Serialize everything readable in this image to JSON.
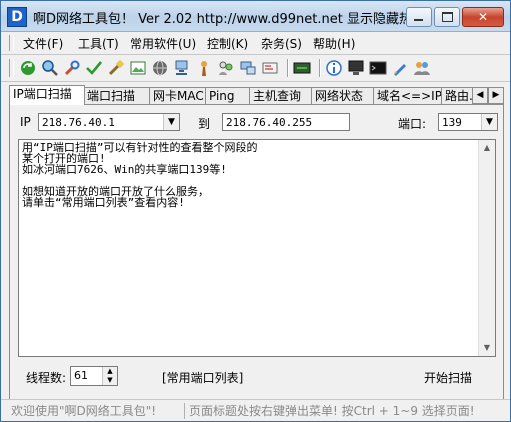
{
  "window": {
    "app_icon": "D",
    "title": "啊D网络工具包！ Ver 2.02   http://www.d99net.net  显示隐藏热..."
  },
  "menu": [
    "文件(F)",
    "工具(T)",
    "常用软件(U)",
    "控制(K)",
    "杂务(S)",
    "帮助(H)"
  ],
  "toolbar": {
    "icons": [
      "refresh-icon",
      "search-icon",
      "wrench-icon",
      "check-icon",
      "brush-icon",
      "image-icon",
      "globe-icon",
      "network-icon",
      "user-icon",
      "users-icon",
      "computer-icon",
      "card-icon",
      "terminal-icon",
      "info-icon",
      "monitor-icon",
      "cmd-icon",
      "pen-icon",
      "people-icon"
    ]
  },
  "tabs": [
    "IP端口扫描",
    "端口扫描",
    "网卡MAC",
    "Ping",
    "主机查询",
    "网络状态",
    "域名<=>IP",
    "路由..."
  ],
  "active_tab": 0,
  "scan": {
    "ip_label": "IP",
    "ip_from": "218.76.40.1",
    "to_label": "到",
    "ip_to": "218.76.40.255",
    "port_label": "端口:",
    "port_value": "139"
  },
  "result_text": "用“IP端口扫描”可以有针对性的查看整个网段的\n某个打开的端口!\n如冰河端口7626、Win的共享端口139等!\n\n如想知道开放的端口开放了什么服务，\n请单击“常用端口列表”查看内容!",
  "bottom": {
    "threads_label": "线程数:",
    "threads_value": "61",
    "port_list_link": "[常用端口列表]",
    "start_button": "开始扫描"
  },
  "status": {
    "welcome": "欢迎使用\"啊D网络工具包\"!",
    "hint": "页面标题处按右键弹出菜单! 按Ctrl + 1~9  选择页面!"
  }
}
